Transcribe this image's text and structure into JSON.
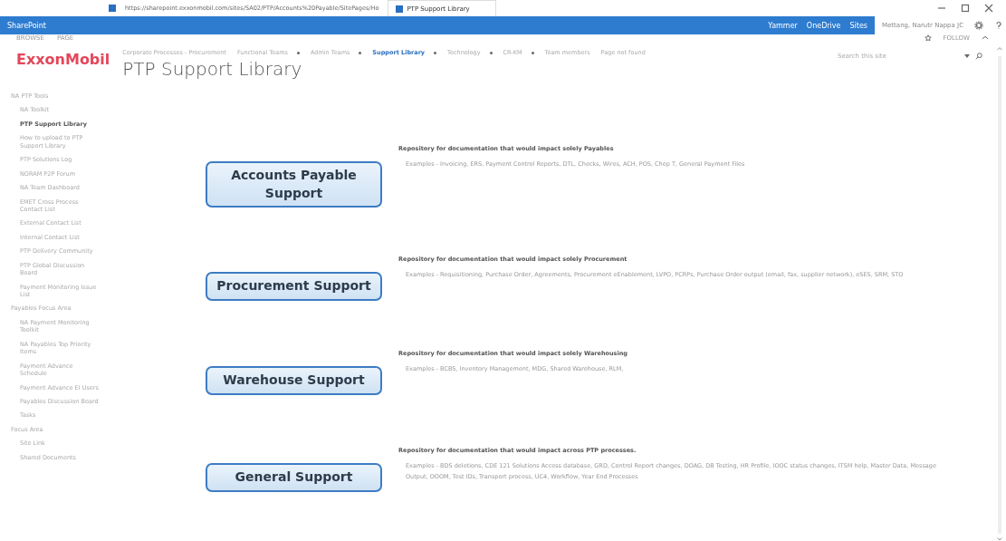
{
  "browser": {
    "url": "https://sharepoint.exxonmobil.com/sites/SA02/PTP/Accounts%20Payable/SitePages/Ho",
    "tab": "PTP Support Library"
  },
  "suite_bar": {
    "brand": "SharePoint",
    "links": [
      "Yammer",
      "OneDrive",
      "Sites"
    ],
    "user": "Mettang, Narutr Nappa JC"
  },
  "ribbon": {
    "tabs": [
      "BROWSE",
      "PAGE"
    ],
    "follow": "FOLLOW"
  },
  "header": {
    "logo": "ExxonMobil",
    "title": "PTP Support Library",
    "search": {
      "placeholder": "Search this site"
    },
    "nav": [
      {
        "label": "Corporate Processes - Procurement",
        "selected": false,
        "has_menu": false
      },
      {
        "label": "Functional Teams",
        "selected": false,
        "has_menu": true
      },
      {
        "label": "Admin Teams",
        "selected": false,
        "has_menu": true
      },
      {
        "label": "Support Library",
        "selected": true,
        "has_menu": true
      },
      {
        "label": "Technology",
        "selected": false,
        "has_menu": true
      },
      {
        "label": "CR-KM",
        "selected": false,
        "has_menu": true
      },
      {
        "label": "Team members",
        "selected": false,
        "has_menu": false
      },
      {
        "label": "Page not found",
        "selected": false,
        "has_menu": false
      }
    ]
  },
  "sidebar": [
    {
      "label": "NA PTP Tools",
      "selected": false,
      "children": [
        {
          "label": "NA Toolkit",
          "selected": false
        },
        {
          "label": "PTP Support Library",
          "selected": true
        },
        {
          "label": "How to upload to PTP Support Library",
          "selected": false
        },
        {
          "label": "PTP Solutions Log",
          "selected": false
        },
        {
          "label": "NORAM P2P Forum",
          "selected": false
        },
        {
          "label": "NA Team Dashboard",
          "selected": false
        },
        {
          "label": "EMET Cross Process Contact List",
          "selected": false
        },
        {
          "label": "External Contact List",
          "selected": false
        },
        {
          "label": "Internal Contact List",
          "selected": false
        },
        {
          "label": "PTP Delivery Community",
          "selected": false
        },
        {
          "label": "PTP Global Discussion Board",
          "selected": false
        },
        {
          "label": "Payment Monitoring Issue List",
          "selected": false
        }
      ]
    },
    {
      "label": "Payables Focus Area",
      "selected": false,
      "children": [
        {
          "label": "NA Payment Monitoring Toolkit",
          "selected": false
        },
        {
          "label": "NA Payables Top Priority Items",
          "selected": false
        },
        {
          "label": "Payment Advance Schedule",
          "selected": false
        },
        {
          "label": "Payment Advance EI Users",
          "selected": false
        },
        {
          "label": "Payables Discussion Board",
          "selected": false
        },
        {
          "label": "Tasks",
          "selected": false
        }
      ]
    },
    {
      "label": "Focus Area",
      "selected": false,
      "children": [
        {
          "label": "Site Link",
          "selected": false
        },
        {
          "label": "Shared Documents",
          "selected": false
        }
      ]
    }
  ],
  "sections": [
    {
      "button": "Accounts Payable Support",
      "heading": "Repository for documentation that would impact solely Payables",
      "examples": "Examples - Invoicing, ERS, Payment Control Reports, DTL, Checks, Wires, ACH, POS, Chep T, General Payment Files"
    },
    {
      "button": "Procurement Support",
      "heading": "Repository for documentation that would impact solely Procurement",
      "examples": "Examples - Requisitioning, Purchase Order, Agreements, Procurement eEnablement, LVPO, PCRPs, Purchase Order output (email, fax, supplier network), eSES, SRM, STO"
    },
    {
      "button": "Warehouse Support",
      "heading": "Repository for documentation that would impact solely Warehousing",
      "examples": "Examples - BCBS, Inventory Management, MDG, Shared Warehouse, RLM,"
    },
    {
      "button": "General Support",
      "heading": "Repository for documentation that would impact across PTP processes.",
      "examples": "Examples - BDS deletions, CDE 121 Solutions Access database, GRD, Control Report changes, DOAG, DB Testing, HR Profile, IOOC status changes, ITSM help, Master Data, Message Output, OOOM, Test IDs, Transport process, UC4, Workflow, Year End Processes"
    }
  ]
}
